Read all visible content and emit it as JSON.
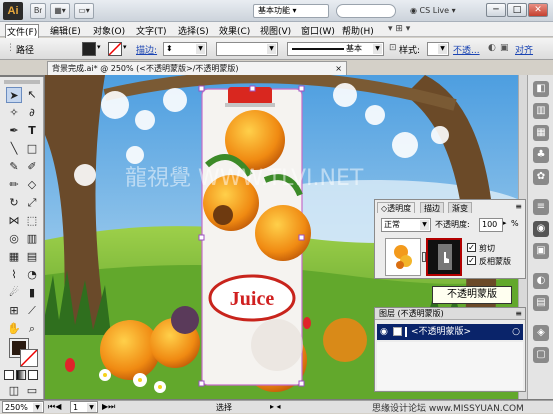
{
  "window": {
    "app_logo": "Ai",
    "bridge_label": "Br",
    "workspace": "基本功能",
    "cslive": "CS Live",
    "minimize": "─",
    "maximize": "□",
    "close": "✕"
  },
  "menu": [
    "文件(F)",
    "编辑(E)",
    "对象(O)",
    "文字(T)",
    "选择(S)",
    "效果(C)",
    "视图(V)",
    "窗口(W)",
    "帮助(H)"
  ],
  "options": {
    "path_label": "路径",
    "stroke_label": "描边:",
    "basic_label": "基本",
    "style_label": "样式:",
    "opacity_label": "不透...",
    "align_label": "对齐"
  },
  "document": {
    "tab_title": "背景完成.ai* @ 250% (<不透明蒙版>/不透明蒙版)",
    "close": "×",
    "watermark": "龍視覺 WWW.TLVI.NET",
    "juice_label": "Juice"
  },
  "transparency_panel": {
    "tab_transparency": "◇透明度",
    "tab_stroke": "描边",
    "tab_gradient": "渐变",
    "blend_mode": "正常",
    "opacity_label": "不透明度:",
    "opacity_value": "100",
    "opacity_unit": "%",
    "clip_label": "剪切",
    "invert_label": "反相蒙版"
  },
  "tooltip": "不透明蒙版",
  "layers_panel": {
    "title": "图层 (不透明蒙版)",
    "layer_name": "<不透明蒙版>"
  },
  "status": {
    "zoom": "250%",
    "page": "1",
    "mode": "选择"
  },
  "footer_watermark": "思缘设计论坛  www.MISSYUAN.COM"
}
